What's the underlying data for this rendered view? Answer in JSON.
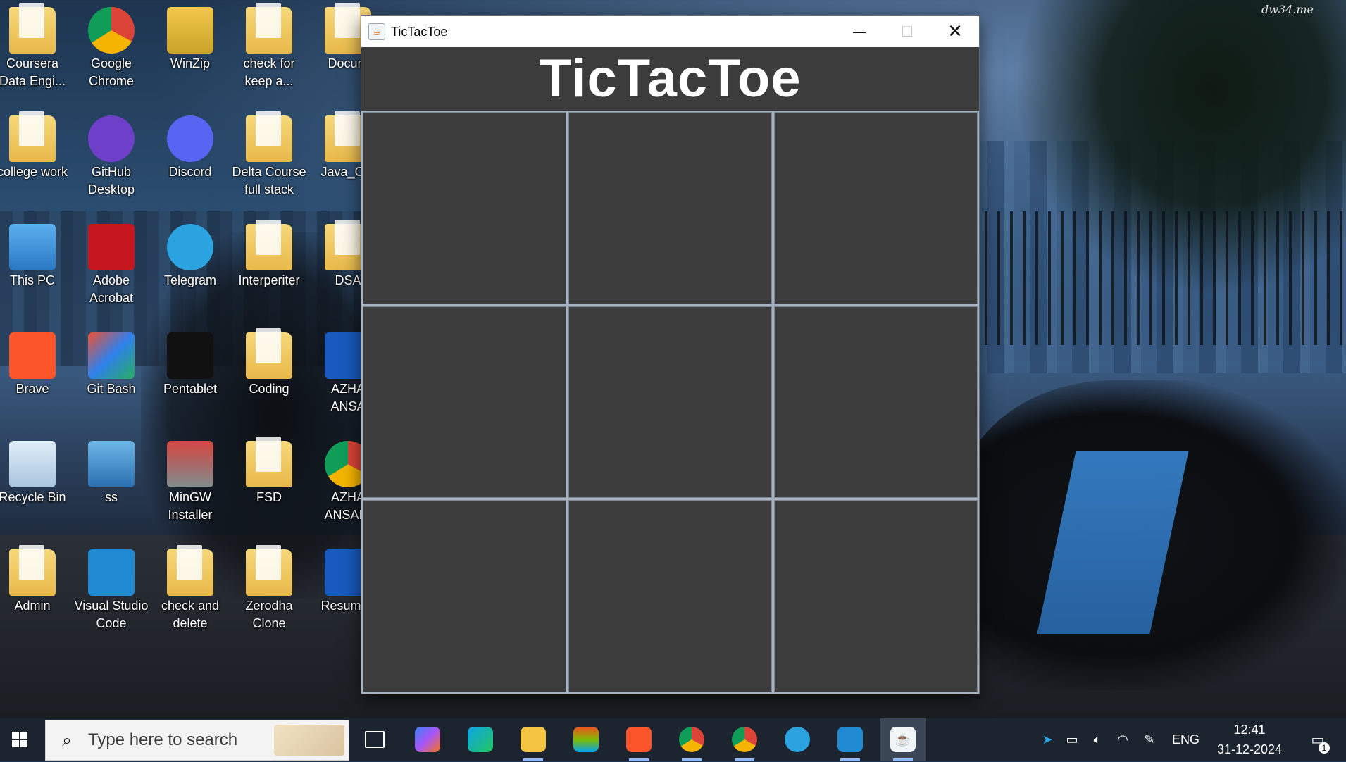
{
  "wallpaper_watermark": "dw34.me",
  "desktop_icons": [
    {
      "label": "Coursera\nData Engi...",
      "icon": "folder-icon"
    },
    {
      "label": "Google\nChrome",
      "icon": "chrome-icon"
    },
    {
      "label": "WinZip",
      "icon": "winzip-icon"
    },
    {
      "label": "check for\nkeep a...",
      "icon": "folder-icon"
    },
    {
      "label": "Docum",
      "icon": "folder-icon"
    },
    {
      "label": "college work",
      "icon": "folder-icon"
    },
    {
      "label": "GitHub\nDesktop",
      "icon": "github-icon"
    },
    {
      "label": "Discord",
      "icon": "discord-icon"
    },
    {
      "label": "Delta Course\nfull stack",
      "icon": "pdf-icon"
    },
    {
      "label": "Java_Cor",
      "icon": "pdf-icon"
    },
    {
      "label": "This PC",
      "icon": "computer-icon"
    },
    {
      "label": "Adobe\nAcrobat",
      "icon": "acrobat-icon"
    },
    {
      "label": "Telegram",
      "icon": "telegram-icon"
    },
    {
      "label": "Interperiter",
      "icon": "folder-icon"
    },
    {
      "label": "DSA",
      "icon": "folder-icon"
    },
    {
      "label": "Brave",
      "icon": "brave-icon"
    },
    {
      "label": "Git Bash",
      "icon": "git-icon"
    },
    {
      "label": "Pentablet",
      "icon": "xppen-icon"
    },
    {
      "label": "Coding",
      "icon": "folder-icon"
    },
    {
      "label": "AZHA\nANSA",
      "icon": "word-icon"
    },
    {
      "label": "Recycle Bin",
      "icon": "recycle-bin-icon"
    },
    {
      "label": "ss",
      "icon": "app-icon"
    },
    {
      "label": "MinGW\nInstaller",
      "icon": "installer-icon"
    },
    {
      "label": "FSD",
      "icon": "folder-icon"
    },
    {
      "label": "AZHA\nANSARI",
      "icon": "chrome-icon"
    },
    {
      "label": "Admin",
      "icon": "user-folder-icon"
    },
    {
      "label": "Visual Studio\nCode",
      "icon": "vscode-icon"
    },
    {
      "label": "check and\ndelete",
      "icon": "pdf-icon"
    },
    {
      "label": "Zerodha\nClone",
      "icon": "folder-icon"
    },
    {
      "label": "Resume_",
      "icon": "word-icon"
    }
  ],
  "window": {
    "title": "TicTacToe",
    "heading": "TicTacToe",
    "minimize_glyph": "—",
    "maximize_glyph": "☐",
    "close_glyph": "✕",
    "board": [
      "",
      "",
      "",
      "",
      "",
      "",
      "",
      "",
      ""
    ]
  },
  "taskbar": {
    "search_placeholder": "Type here to search",
    "apps": [
      "task-view-icon",
      "copilot-icon",
      "edge-icon",
      "file-explorer-icon",
      "microsoft-store-icon",
      "brave-icon",
      "chrome-icon",
      "chrome-profile-icon",
      "telegram-icon",
      "vscode-icon",
      "java-icon"
    ],
    "language": "ENG",
    "time": "12:41",
    "date": "31-12-2024",
    "notification_count": "1"
  }
}
